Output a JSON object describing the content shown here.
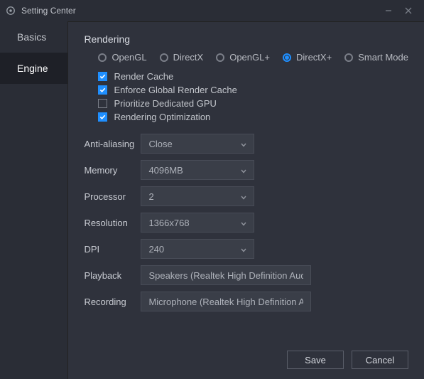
{
  "window": {
    "title": "Setting Center"
  },
  "sidebar": {
    "items": [
      {
        "label": "Basics"
      },
      {
        "label": "Engine"
      }
    ],
    "active_index": 1
  },
  "section": {
    "title": "Rendering"
  },
  "render_modes": [
    {
      "label": "OpenGL",
      "selected": false
    },
    {
      "label": "DirectX",
      "selected": false
    },
    {
      "label": "OpenGL+",
      "selected": false
    },
    {
      "label": "DirectX+",
      "selected": true
    },
    {
      "label": "Smart Mode",
      "selected": false
    }
  ],
  "render_checks": [
    {
      "label": "Render Cache",
      "checked": true
    },
    {
      "label": "Enforce Global Render Cache",
      "checked": true
    },
    {
      "label": "Prioritize Dedicated GPU",
      "checked": false
    },
    {
      "label": "Rendering Optimization",
      "checked": true
    }
  ],
  "fields": {
    "anti_aliasing": {
      "label": "Anti-aliasing",
      "value": "Close"
    },
    "memory": {
      "label": "Memory",
      "value": "4096MB"
    },
    "processor": {
      "label": "Processor",
      "value": "2"
    },
    "resolution": {
      "label": "Resolution",
      "value": "1366x768"
    },
    "dpi": {
      "label": "DPI",
      "value": "240"
    },
    "playback": {
      "label": "Playback",
      "value": "Speakers (Realtek High Definition Audio)"
    },
    "recording": {
      "label": "Recording",
      "value": "Microphone (Realtek High Definition Audio)"
    }
  },
  "footer": {
    "save": "Save",
    "cancel": "Cancel"
  }
}
